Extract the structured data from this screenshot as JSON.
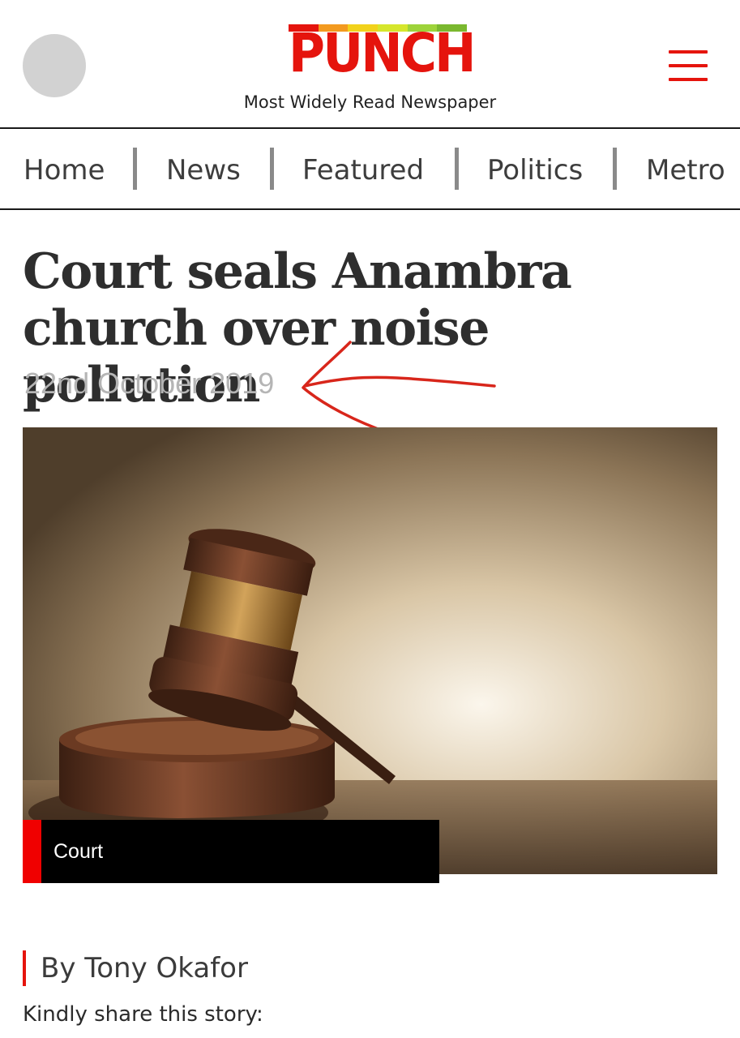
{
  "header": {
    "logo_text": "PUNCH",
    "tagline": "Most Widely Read Newspaper",
    "logo_bar_colors": [
      "#e5140d",
      "#f39a1f",
      "#f2d21b",
      "#d6e62c",
      "#9dd33a",
      "#7ab82f"
    ],
    "brand_color": "#e5140d",
    "menu_icon": "hamburger-menu-icon"
  },
  "nav": {
    "items": [
      "Home",
      "News",
      "Featured",
      "Politics",
      "Metro"
    ]
  },
  "article": {
    "headline": "Court seals Anambra church over noise pollution",
    "date": "22nd October 2019",
    "image_subject": "wooden-gavel-image",
    "category": "Court",
    "author": "By Tony Okafor",
    "share_prompt": "Kindly share this story:"
  },
  "annotation": {
    "color": "#d8261b",
    "type": "hand-drawn-arrow"
  }
}
